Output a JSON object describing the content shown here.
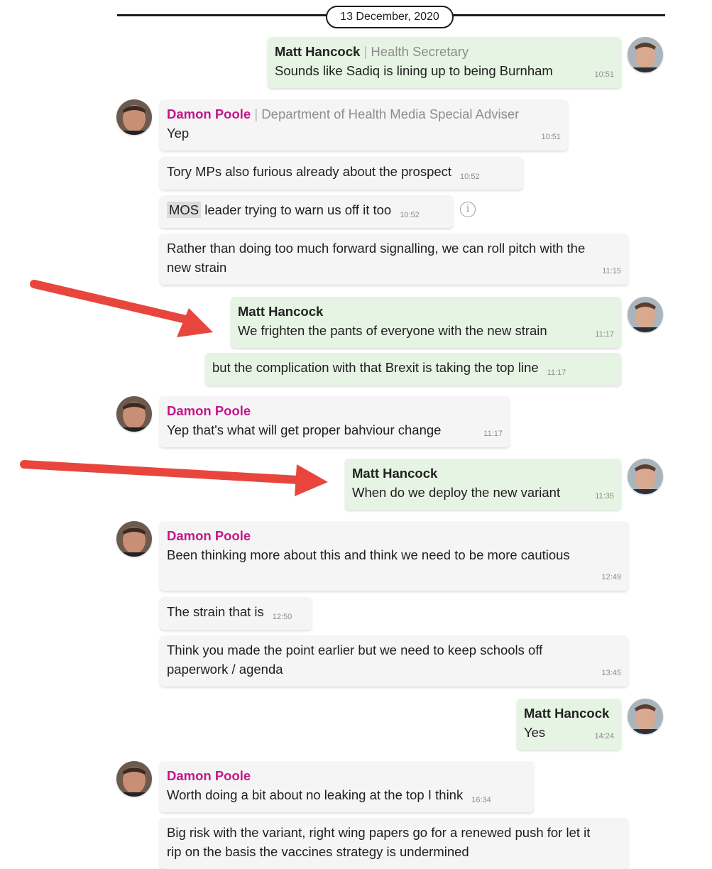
{
  "date_separator": "13 December, 2020",
  "messages": [
    {
      "sender": "Matt Hancock",
      "role": "Health Secretary",
      "text": "Sounds like Sadiq is lining up to being Burnham",
      "time": "10:51"
    },
    {
      "sender": "Damon Poole",
      "role": "Department of Health Media Special Adviser",
      "text": "Yep",
      "time": "10:51"
    },
    {
      "text": "Tory MPs also furious already about the prospect",
      "time": "10:52"
    },
    {
      "chip": "MOS",
      "text": "leader trying to warn us off it too",
      "time": "10:52"
    },
    {
      "text": "Rather than doing too much forward signalling, we can roll pitch with the new strain",
      "time": "11:15"
    },
    {
      "sender": "Matt Hancock",
      "text": "We frighten the pants of everyone with the new strain",
      "time": "11:17"
    },
    {
      "text": "but the complication with that Brexit is taking the top line",
      "time": "11:17"
    },
    {
      "sender": "Damon Poole",
      "text": "Yep that's what will get proper bahviour change",
      "time": "11:17"
    },
    {
      "sender": "Matt Hancock",
      "text": "When do we deploy the new variant",
      "time": "11:35"
    },
    {
      "sender": "Damon Poole",
      "text": "Been thinking more about this and think we need to be more cautious",
      "time": "12:49"
    },
    {
      "text": "The strain that is",
      "time": "12:50"
    },
    {
      "text": "Think you made the point earlier but we need to keep schools off paperwork / agenda",
      "time": "13:45"
    },
    {
      "sender": "Matt Hancock",
      "text": "Yes",
      "time": "14:24"
    },
    {
      "sender": "Damon Poole",
      "text": "Worth doing a bit about no leaking at the top I think",
      "time": "16:34"
    },
    {
      "text": "Big risk with the variant, right wing papers go for a renewed push for let it rip on the basis the vaccines strategy is undermined"
    }
  ],
  "icons": {
    "info": "info-circle-icon",
    "arrow": "red-arrow-icon",
    "avatar": "avatar-photo"
  },
  "colors": {
    "incoming_bubble": "#f5f5f5",
    "outgoing_bubble": "#e6f4e3",
    "damon_name": "#c4168a",
    "arrow": "#e8463c"
  }
}
